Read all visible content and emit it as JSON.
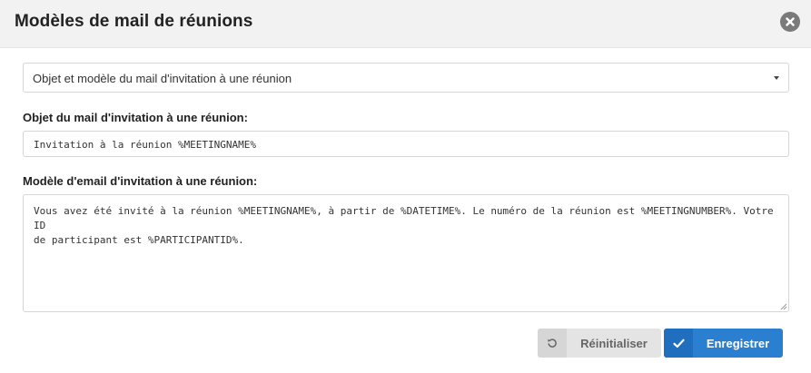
{
  "dialog": {
    "title": "Modèles de mail de réunions",
    "close_icon": "close-icon"
  },
  "template_select": {
    "selected": "Objet et modèle du mail d'invitation à une réunion"
  },
  "subject": {
    "label": "Objet du mail d'invitation à une réunion:",
    "value": "Invitation à la réunion %MEETINGNAME%"
  },
  "body": {
    "label": "Modèle d'email d'invitation à une réunion:",
    "value": "Vous avez été invité à la réunion %MEETINGNAME%, à partir de %DATETIME%. Le numéro de la réunion est %MEETINGNUMBER%. Votre ID\nde participant est %PARTICIPANTID%."
  },
  "buttons": {
    "reset_label": "Réinitialiser",
    "reset_icon": "undo-icon",
    "save_label": "Enregistrer",
    "save_icon": "check-icon"
  },
  "colors": {
    "primary": "#2a7fd0",
    "header_bg": "#f2f2f2"
  }
}
